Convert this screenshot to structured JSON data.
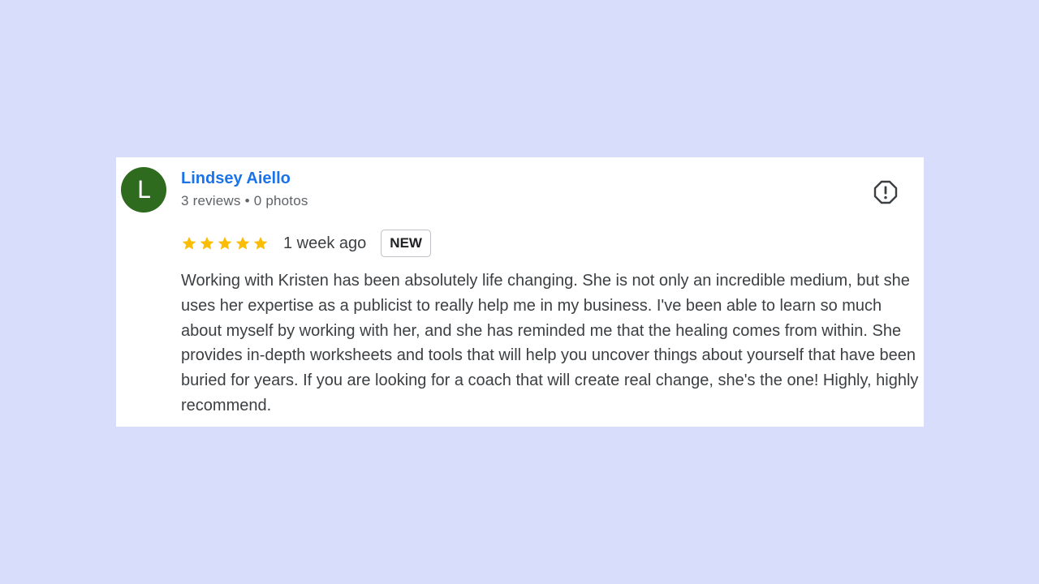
{
  "reviewer": {
    "initial": "L",
    "name": "Lindsey Aiello",
    "reviews": "3 reviews",
    "separator": "•",
    "photos": "0 photos",
    "avatar_color": "#2f6b1f"
  },
  "rating": {
    "stars": 5,
    "max_stars": 5,
    "star_color": "#fbbc04",
    "date": "1 week ago",
    "badge": "NEW"
  },
  "review": {
    "text": "Working with Kristen has been absolutely life changing. She is not only an incredible medium, but she uses her expertise as a publicist to really help me in my business. I've been able to learn so much about myself by working with her, and she has reminded me that the healing comes from within. She provides in-depth worksheets and tools that will help you uncover things about yourself that have been buried for years. If you are looking for a coach that will create real change, she's the one! Highly, highly recommend."
  },
  "actions": {
    "report_icon": "report-flag-icon"
  },
  "colors": {
    "background": "#d8ddfc",
    "name_link": "#1a73e8"
  }
}
